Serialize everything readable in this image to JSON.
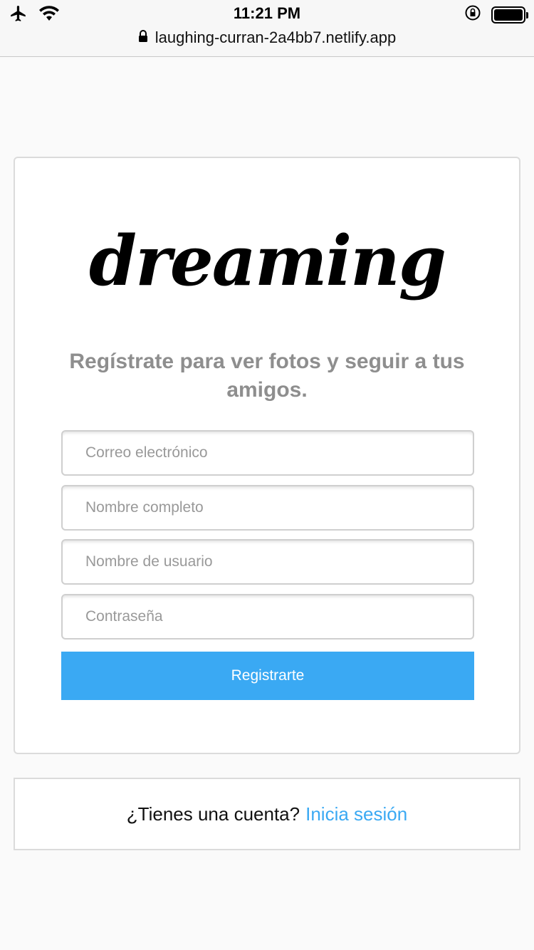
{
  "status_bar": {
    "time": "11:21 PM",
    "icons": [
      "airplane-icon",
      "wifi-icon",
      "rotation-lock-icon",
      "battery-icon"
    ]
  },
  "browser": {
    "url": "laughing-curran-2a4bb7.netlify.app"
  },
  "signup": {
    "logo": "dreaming",
    "tagline": "Regístrate para ver fotos y seguir a tus amigos.",
    "fields": {
      "email_placeholder": "Correo electrónico",
      "fullname_placeholder": "Nombre completo",
      "username_placeholder": "Nombre de usuario",
      "password_placeholder": "Contraseña"
    },
    "submit_label": "Registrarte"
  },
  "login": {
    "prompt": "¿Tienes una cuenta?",
    "link_label": "Inicia sesión"
  },
  "colors": {
    "accent": "#3aa9f3",
    "tagline": "#8e8e8e",
    "background": "#fafafa",
    "border": "#dbdbdb"
  }
}
